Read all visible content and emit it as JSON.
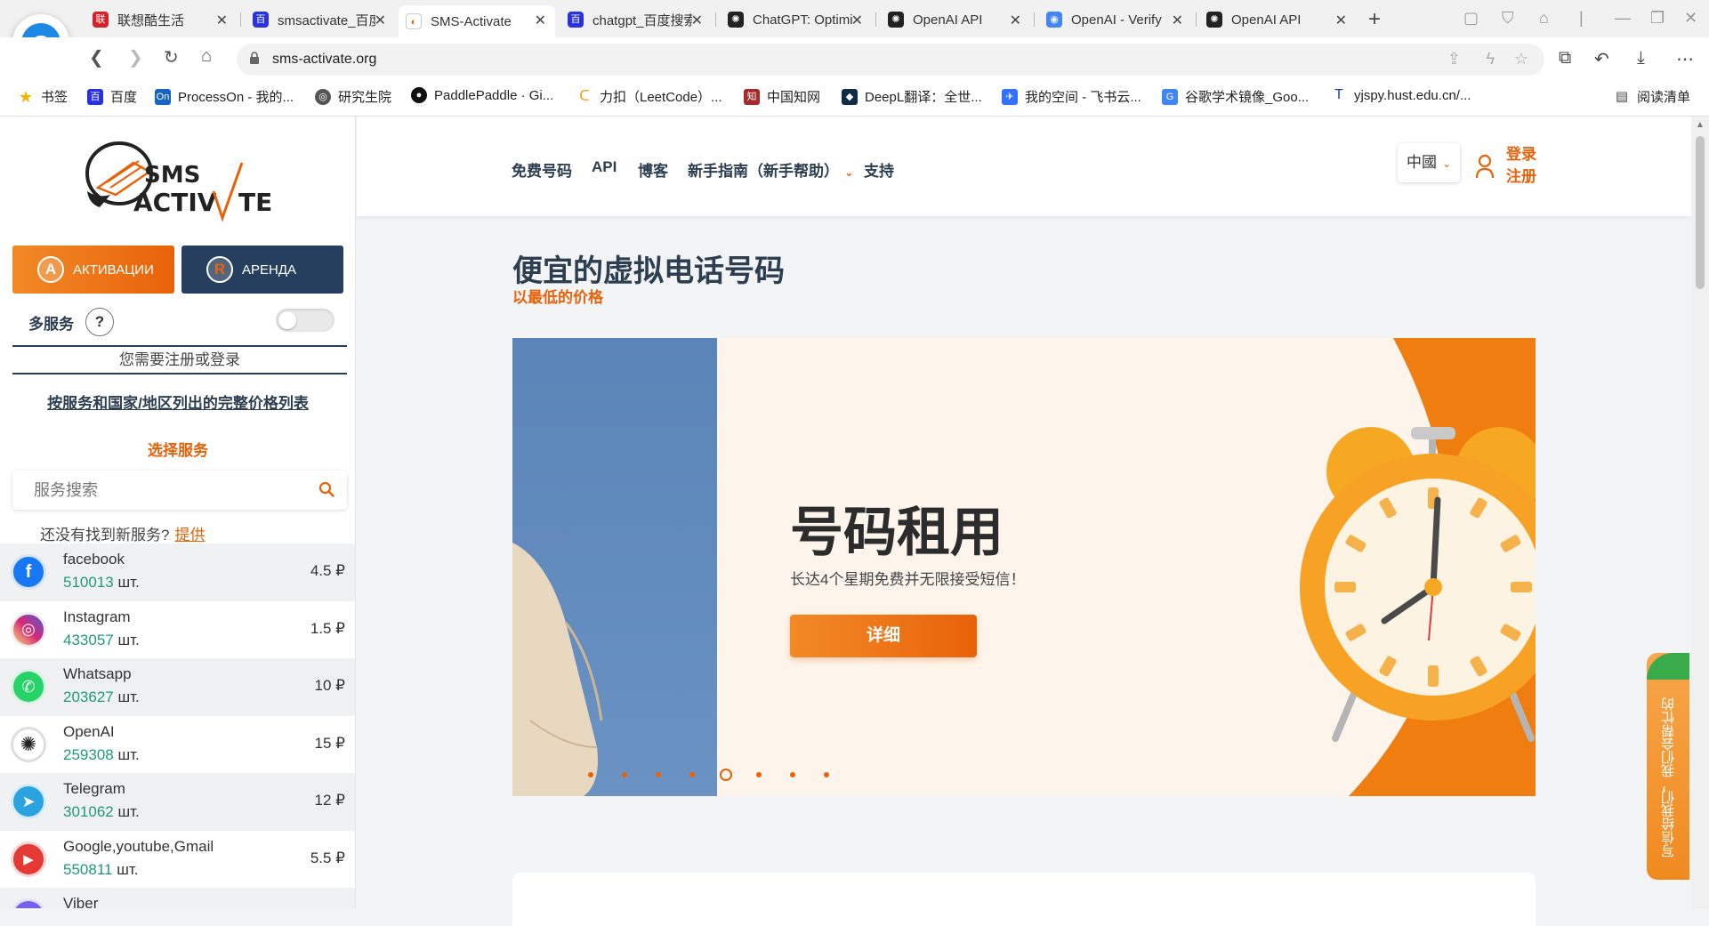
{
  "browser": {
    "tabs": [
      {
        "label": "联想酷生活",
        "icon": "lenovo-icon",
        "color": "#d6202a"
      },
      {
        "label": "smsactivate_百度搜索",
        "icon": "baidu-icon",
        "color": "#2932e1"
      },
      {
        "label": "SMS-Activate",
        "icon": "sms-activate-icon",
        "color": "#ffffff"
      },
      {
        "label": "chatgpt_百度搜索",
        "icon": "baidu-icon",
        "color": "#2932e1"
      },
      {
        "label": "ChatGPT: Optimizing",
        "icon": "openai-icon",
        "color": "#222222"
      },
      {
        "label": "OpenAI API",
        "icon": "openai-icon",
        "color": "#222222"
      },
      {
        "label": "OpenAI - Verify",
        "icon": "chrome-icon",
        "color": "#4285f4"
      },
      {
        "label": "OpenAI API",
        "icon": "openai-icon",
        "color": "#222222"
      }
    ],
    "url": "sms-activate.org",
    "bookmarks": [
      {
        "label": "书签",
        "icon": "star-icon",
        "color": "#f5b400"
      },
      {
        "label": "百度",
        "icon": "baidu-icon",
        "color": "#2932e1"
      },
      {
        "label": "ProcessOn - 我的...",
        "icon": "processon-icon",
        "color": "#1565c0"
      },
      {
        "label": "研究生院",
        "icon": "globe-icon",
        "color": "#555555"
      },
      {
        "label": "PaddlePaddle · Gi...",
        "icon": "github-icon",
        "color": "#111111"
      },
      {
        "label": "力扣（LeetCode）...",
        "icon": "leetcode-icon",
        "color": "#f89f1b"
      },
      {
        "label": "中国知网",
        "icon": "cnki-icon",
        "color": "#a52a2a"
      },
      {
        "label": "DeepL翻译：全世...",
        "icon": "deepl-icon",
        "color": "#0f2b46"
      },
      {
        "label": "我的空间 - 飞书云...",
        "icon": "feishu-icon",
        "color": "#3370ff"
      },
      {
        "label": "谷歌学术镜像_Goo...",
        "icon": "scholar-icon",
        "color": "#4285f4"
      },
      {
        "label": "yjspy.hust.edu.cn/...",
        "icon": "hust-icon",
        "color": "#1a3fb0"
      }
    ],
    "reading_list": "阅读清单"
  },
  "sidebar": {
    "activation_label": "АКТИВАЦИИ",
    "rent_label": "АРЕНДА",
    "multi_service_label": "多服务",
    "help_label": "?",
    "login_required": "您需要注册或登录",
    "price_list_link": "按服务和国家/地区列出的完整价格列表",
    "choose_service": "选择服务",
    "search_placeholder": "服务搜索",
    "not_found_text": "还没有找到新服务?",
    "suggest_link": "提供",
    "services": [
      {
        "name": "facebook",
        "count": "510013",
        "unit": "шт.",
        "price": "4.5 ₽",
        "icon": "facebook-icon",
        "color": "#1877f2"
      },
      {
        "name": "Instagram",
        "count": "433057",
        "unit": "шт.",
        "price": "1.5 ₽",
        "icon": "instagram-icon",
        "color": "#d6249f"
      },
      {
        "name": "Whatsapp",
        "count": "203627",
        "unit": "шт.",
        "price": "10 ₽",
        "icon": "whatsapp-icon",
        "color": "#25d366"
      },
      {
        "name": "OpenAI",
        "count": "259308",
        "unit": "шт.",
        "price": "15 ₽",
        "icon": "openai-icon",
        "color": "#222222"
      },
      {
        "name": "Telegram",
        "count": "301062",
        "unit": "шт.",
        "price": "12 ₽",
        "icon": "telegram-icon",
        "color": "#2aa3e0"
      },
      {
        "name": "Google,youtube,Gmail",
        "count": "550811",
        "unit": "шт.",
        "price": "5.5 ₽",
        "icon": "youtube-icon",
        "color": "#e53935"
      },
      {
        "name": "Viber",
        "count": "",
        "unit": "",
        "price": "",
        "icon": "viber-icon",
        "color": "#7360f2"
      }
    ]
  },
  "header": {
    "nav": [
      "免费号码",
      "API",
      "博客",
      "新手指南（新手帮助）",
      "支持"
    ],
    "language": "中國",
    "login": "登录",
    "register": "注册"
  },
  "hero": {
    "title": "便宜的虚拟电话号码",
    "subtitle": "以最低的价格"
  },
  "banner": {
    "title": "号码租用",
    "description": "长达4个星期免费并无限接受短信！",
    "button": "详细",
    "slides": 8,
    "active_slide": 5
  },
  "feedback": "写信给我们，我们会帮忙的",
  "colors": {
    "accent": "#e8620a",
    "navy": "#263f5e",
    "count_green": "#1f9a78"
  }
}
